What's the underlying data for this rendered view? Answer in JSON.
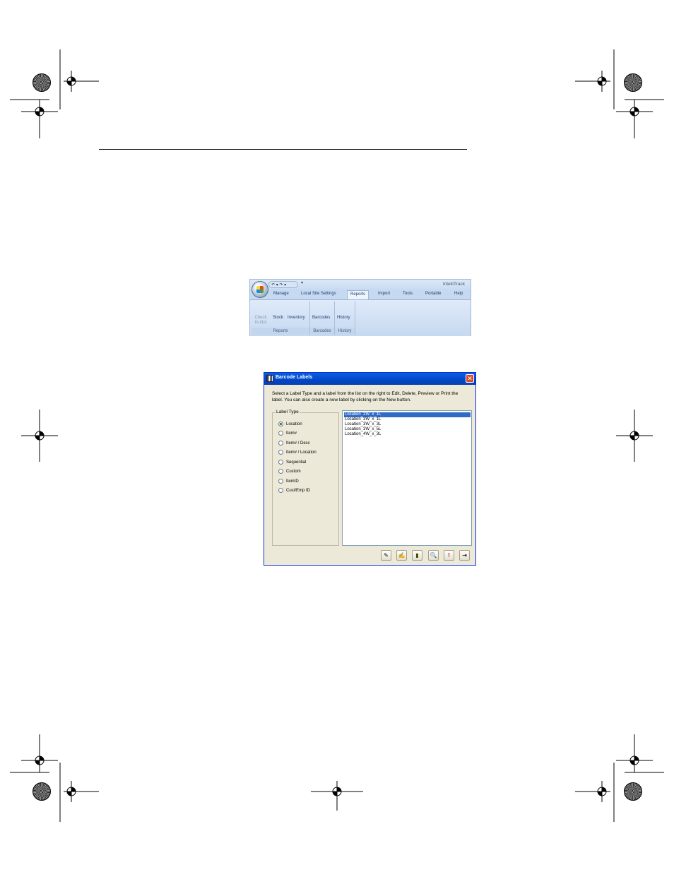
{
  "ribbon": {
    "app_title": "IntelliTrack",
    "qat_items": "↶ ▾ ↷ ▾",
    "qat_more": "▾",
    "tabs": [
      "Manage",
      "Local Site Settings",
      "Reports",
      "Import",
      "Tools",
      "Portable",
      "Help"
    ],
    "active_tab": "Reports",
    "groups": {
      "reports": {
        "caption": "Reports",
        "buttons": [
          "Check In-Out",
          "Stock",
          "Inventory"
        ]
      },
      "barcodes": {
        "caption": "Barcodes",
        "buttons": [
          "Barcodes"
        ]
      },
      "history": {
        "caption": "History",
        "buttons": [
          "History"
        ]
      }
    }
  },
  "dialog": {
    "title": "Barcode Labels",
    "close_label": "✕",
    "instructions": "Select a Label Type and a label from the list on the right to Edit, Delete, Preview or Print the label. You can also create a new label by clicking on the New button.",
    "label_type_legend": "Label Type",
    "label_types": [
      "Location",
      "Item#",
      "Item# / Desc",
      "Item# / Location",
      "Sequential",
      "Custom",
      "ItemID",
      "Cust/Emp ID"
    ],
    "selected_label_type": "Location",
    "labels": [
      "Location_2W_x_1L",
      "Location_3W_x_1L",
      "Location_3W_x_3L",
      "Location_3W_x_5L",
      "Location_4W_x_3L"
    ],
    "selected_label": "Location_2W_x_1L",
    "toolbar_icons": [
      "new-label-icon",
      "edit-label-icon",
      "delete-label-icon",
      "preview-label-icon",
      "print-label-icon",
      "exit-icon"
    ],
    "toolbar_glyphs": [
      "✎",
      "✍",
      "▮",
      "🔍",
      "!",
      "⇥"
    ]
  },
  "colors": {
    "title_bar": "#0047c8",
    "selection": "#316ac5",
    "dialog_face": "#ece9d8",
    "ribbon_bg": "#c5d9f1"
  }
}
